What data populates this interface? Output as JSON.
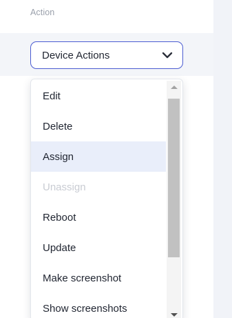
{
  "table": {
    "column_header": "Action"
  },
  "select": {
    "value": "Device Actions",
    "icon": "chevron-down-icon",
    "accent_color": "#4a5bd1"
  },
  "menu": {
    "items": [
      {
        "label": "Edit",
        "state": "normal"
      },
      {
        "label": "Delete",
        "state": "normal"
      },
      {
        "label": "Assign",
        "state": "highlighted"
      },
      {
        "label": "Unassign",
        "state": "disabled"
      },
      {
        "label": "Reboot",
        "state": "normal"
      },
      {
        "label": "Update",
        "state": "normal"
      },
      {
        "label": "Make screenshot",
        "state": "normal"
      },
      {
        "label": "Show screenshots",
        "state": "normal"
      }
    ]
  }
}
